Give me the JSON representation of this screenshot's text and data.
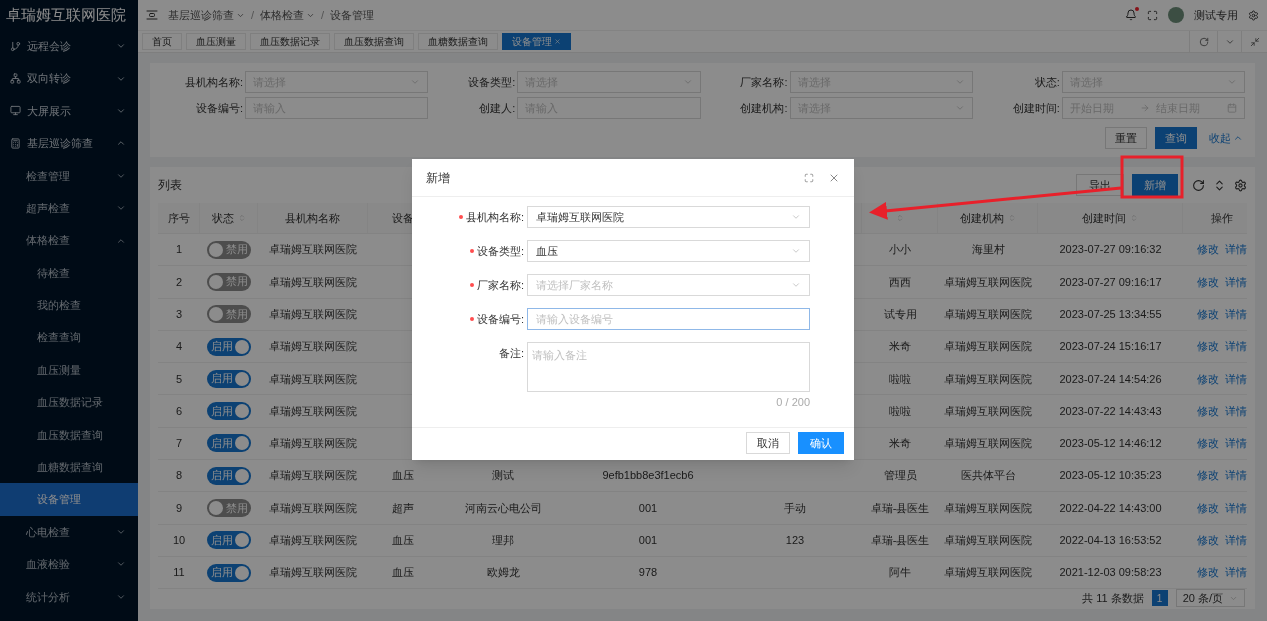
{
  "app": {
    "title": "卓瑞姆互联网医院"
  },
  "sidebar": {
    "items": [
      {
        "label": "远程会诊",
        "expanded": false,
        "selected": false
      },
      {
        "label": "双向转诊",
        "expanded": false,
        "selected": false
      },
      {
        "label": "大屏展示",
        "expanded": false,
        "selected": false
      },
      {
        "label": "基层巡诊筛查",
        "expanded": true,
        "selected": false,
        "children": [
          {
            "label": "检查管理",
            "expanded": false,
            "selected": false
          },
          {
            "label": "超声检查",
            "expanded": false,
            "selected": false
          },
          {
            "label": "体格检查",
            "expanded": true,
            "selected": false,
            "children": [
              {
                "label": "待检查",
                "selected": false
              },
              {
                "label": "我的检查",
                "selected": false
              },
              {
                "label": "检查查询",
                "selected": false
              },
              {
                "label": "血压测量",
                "selected": false
              },
              {
                "label": "血压数据记录",
                "selected": false
              },
              {
                "label": "血压数据查询",
                "selected": false
              },
              {
                "label": "血糖数据查询",
                "selected": false
              },
              {
                "label": "设备管理",
                "selected": true
              }
            ]
          },
          {
            "label": "心电检查",
            "expanded": false,
            "selected": false
          },
          {
            "label": "血液检验",
            "expanded": false,
            "selected": false
          },
          {
            "label": "统计分析",
            "expanded": false,
            "selected": false
          }
        ]
      }
    ]
  },
  "header": {
    "breadcrumb": [
      {
        "label": "基层巡诊筛查",
        "dropdown": true
      },
      {
        "label": "体格检查",
        "dropdown": true
      },
      {
        "label": "设备管理",
        "dropdown": false
      }
    ],
    "separator": "/",
    "notification_dot": true,
    "user": "测试专用"
  },
  "tabs": [
    {
      "label": "首页",
      "selected": false
    },
    {
      "label": "血压测量",
      "selected": false
    },
    {
      "label": "血压数据记录",
      "selected": false
    },
    {
      "label": "血压数据查询",
      "selected": false
    },
    {
      "label": "血糖数据查询",
      "selected": false
    },
    {
      "label": "设备管理",
      "selected": true
    }
  ],
  "filters": {
    "fields": [
      {
        "label": "县机构名称:",
        "kind": "select",
        "placeholder": "请选择"
      },
      {
        "label": "设备类型:",
        "kind": "select",
        "placeholder": "请选择"
      },
      {
        "label": "厂家名称:",
        "kind": "select",
        "placeholder": "请选择"
      },
      {
        "label": "状态:",
        "kind": "select",
        "placeholder": "请选择"
      },
      {
        "label": "设备编号:",
        "kind": "input",
        "placeholder": "请输入"
      },
      {
        "label": "创建人:",
        "kind": "input",
        "placeholder": "请输入"
      },
      {
        "label": "创建机构:",
        "kind": "select",
        "placeholder": "请选择"
      },
      {
        "label": "创建时间:",
        "kind": "daterange",
        "placeholder": "开始日期",
        "placeholder_end": "结束日期"
      }
    ],
    "reset": "重置",
    "search": "查询",
    "collapse": "收起"
  },
  "list": {
    "title": "列表",
    "export": "导出",
    "add": "新增",
    "columns": [
      {
        "label": "序号",
        "sortable": false
      },
      {
        "label": "状态",
        "sortable": true
      },
      {
        "label": "县机构名称",
        "sortable": false
      },
      {
        "label": "设备",
        "sortable": false
      },
      {},
      {},
      {},
      {
        "sortable": true
      },
      {
        "label": "创建机构",
        "sortable": true
      },
      {
        "label": "创建时间",
        "sortable": true
      },
      {
        "label": "操作",
        "sortable": false
      }
    ],
    "rows": [
      {
        "index": "1",
        "enabled": false,
        "switch_label": "禁用",
        "county_org": "卓瑞姆互联网医院",
        "column_8": "小小",
        "created_org": "海里村",
        "created_at": "2023-07-27 09:16:32",
        "actions": [
          "修改",
          "详情"
        ]
      },
      {
        "index": "2",
        "enabled": false,
        "switch_label": "禁用",
        "county_org": "卓瑞姆互联网医院",
        "column_8": "西西",
        "created_org": "卓瑞姆互联网医院",
        "created_at": "2023-07-27 09:16:17",
        "actions": [
          "修改",
          "详情"
        ]
      },
      {
        "index": "3",
        "enabled": false,
        "switch_label": "禁用",
        "county_org": "卓瑞姆互联网医院",
        "column_8": "试专用",
        "created_org": "卓瑞姆互联网医院",
        "created_at": "2023-07-25 13:34:55",
        "actions": [
          "修改",
          "详情"
        ]
      },
      {
        "index": "4",
        "enabled": true,
        "switch_label": "启用",
        "county_org": "卓瑞姆互联网医院",
        "column_8": "米奇",
        "created_org": "卓瑞姆互联网医院",
        "created_at": "2023-07-24 15:16:17",
        "actions": [
          "修改",
          "详情"
        ]
      },
      {
        "index": "5",
        "enabled": true,
        "switch_label": "启用",
        "county_org": "卓瑞姆互联网医院",
        "column_8": "啦啦",
        "created_org": "卓瑞姆互联网医院",
        "created_at": "2023-07-24 14:54:26",
        "actions": [
          "修改",
          "详情"
        ]
      },
      {
        "index": "6",
        "enabled": true,
        "switch_label": "启用",
        "county_org": "卓瑞姆互联网医院",
        "column_8": "啦啦",
        "created_org": "卓瑞姆互联网医院",
        "created_at": "2023-07-22 14:43:43",
        "actions": [
          "修改",
          "详情"
        ]
      },
      {
        "index": "7",
        "enabled": true,
        "switch_label": "启用",
        "county_org": "卓瑞姆互联网医院",
        "column_8": "米奇",
        "created_org": "卓瑞姆互联网医院",
        "created_at": "2023-05-12 14:46:12",
        "actions": [
          "修改",
          "详情"
        ]
      },
      {
        "index": "8",
        "enabled": true,
        "switch_label": "启用",
        "county_org": "卓瑞姆互联网医院",
        "device_type": "血压",
        "column_5": "测试",
        "column_6": "9efb1bb8e3f1ecb6",
        "column_8": "管理员",
        "created_org": "医共体平台",
        "created_at": "2023-05-12 10:35:23",
        "actions": [
          "修改",
          "详情"
        ]
      },
      {
        "index": "9",
        "enabled": false,
        "switch_label": "禁用",
        "county_org": "卓瑞姆互联网医院",
        "device_type": "超声",
        "column_5": "河南云心电公司",
        "column_6": "001",
        "column_7": "手动",
        "column_8": "卓瑞-县医生",
        "created_org": "卓瑞姆互联网医院",
        "created_at": "2022-04-22 14:43:00",
        "actions": [
          "修改",
          "详情"
        ]
      },
      {
        "index": "10",
        "enabled": true,
        "switch_label": "启用",
        "county_org": "卓瑞姆互联网医院",
        "device_type": "血压",
        "column_5": "理邦",
        "column_6": "001",
        "column_7": "123",
        "column_8": "卓瑞-县医生",
        "created_org": "卓瑞姆互联网医院",
        "created_at": "2022-04-13 16:53:52",
        "actions": [
          "修改",
          "详情"
        ]
      },
      {
        "index": "11",
        "enabled": true,
        "switch_label": "启用",
        "county_org": "卓瑞姆互联网医院",
        "device_type": "血压",
        "column_5": "欧姆龙",
        "column_6": "978",
        "column_8": "阿牛",
        "created_org": "卓瑞姆互联网医院",
        "created_at": "2021-12-03 09:58:23",
        "actions": [
          "修改",
          "详情"
        ]
      }
    ],
    "pagination": {
      "total": "共 11 条数据",
      "pages": [
        {
          "label": "1",
          "selected": true
        }
      ],
      "page_size": "20 条/页"
    }
  },
  "dialog": {
    "title": "新增",
    "fields": [
      {
        "label": "县机构名称:",
        "required": true,
        "kind": "select",
        "value": "卓瑞姆互联网医院"
      },
      {
        "label": "设备类型:",
        "required": true,
        "kind": "select",
        "value": "血压"
      },
      {
        "label": "厂家名称:",
        "required": true,
        "kind": "select",
        "placeholder": "请选择厂家名称"
      },
      {
        "label": "设备编号:",
        "required": true,
        "kind": "input",
        "placeholder": "请输入设备编号",
        "focused": true
      },
      {
        "label": "备注:",
        "required": false,
        "kind": "textarea",
        "placeholder": "请输入备注",
        "counter": "0 / 200"
      }
    ],
    "cancel": "取消",
    "confirm": "确认"
  }
}
